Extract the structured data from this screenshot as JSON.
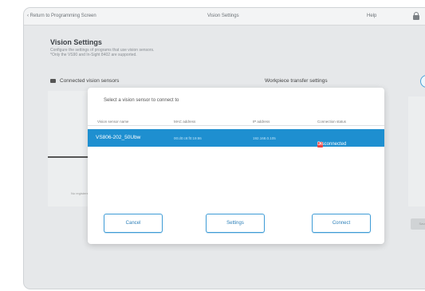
{
  "topbar": {
    "back_label": "Return to Programming Screen",
    "title": "Vision Settings",
    "help_label": "Help"
  },
  "page": {
    "heading": "Vision Settings",
    "description": "Configure the settings of programs that use vision sensors.",
    "description_2": "*Only the VS90 and In-Sight 8402 are supported.",
    "section_left": "Connected vision sensors",
    "section_right": "Workpiece transfer settings",
    "not_registered": "No registered sensors",
    "bg_button": "Save"
  },
  "modal": {
    "title": "Select a vision sensor to connect to",
    "columns": [
      "Vision sensor name",
      "MAC address",
      "IP address",
      "Connection status"
    ],
    "rows": [
      {
        "name": "VS806-202_50Ubw",
        "mac": "00:d0:c9:f0:19:86",
        "ip": "192.168.0.105",
        "status": "Disconnected"
      }
    ],
    "cancel_label": "Cancel",
    "settings_label": "Settings",
    "connect_label": "Connect"
  },
  "colors": {
    "selected_row": "#1e8fd0",
    "button_border": "#3d9bd6",
    "status_disconnected": "#e84545"
  },
  "icons": [
    "back-chevron-icon",
    "lock-icon",
    "camera-icon",
    "disconnected-icon"
  ]
}
